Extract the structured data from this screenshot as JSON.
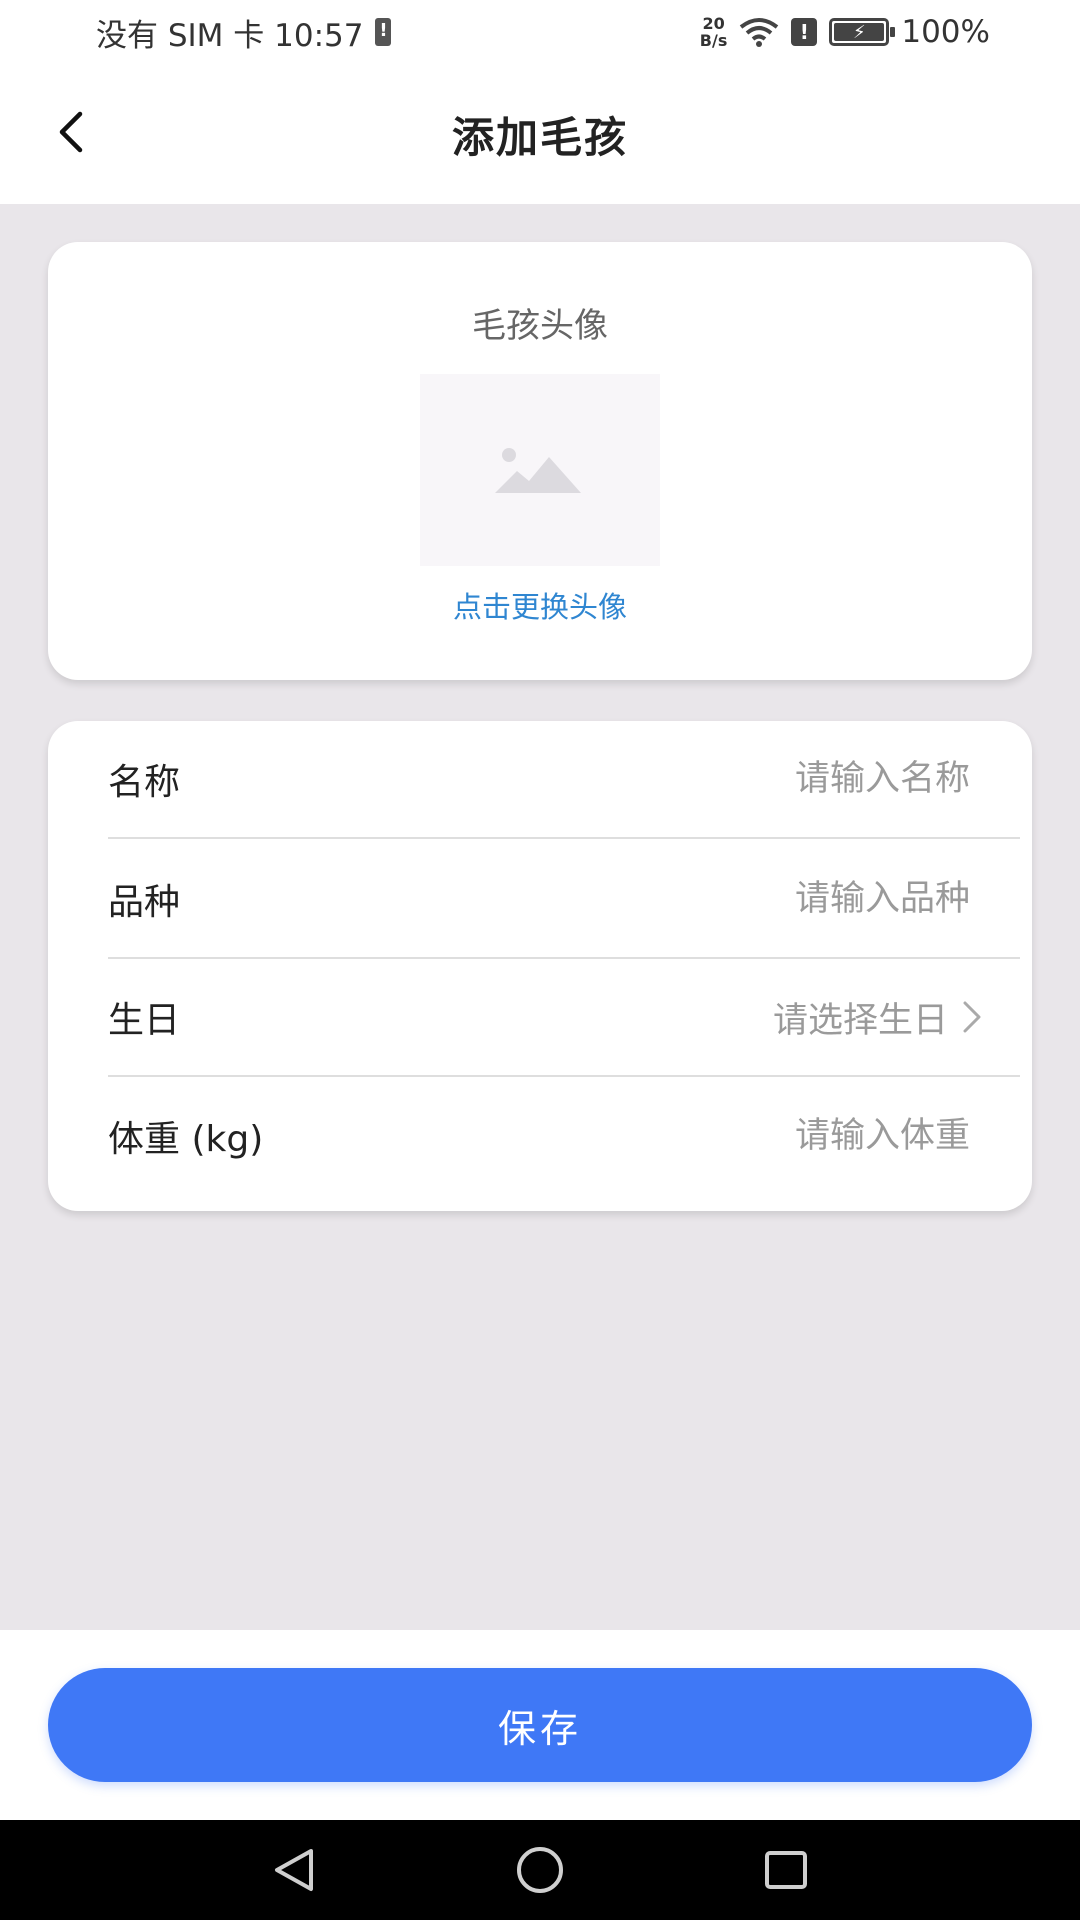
{
  "status_bar": {
    "carrier_time": "没有 SIM 卡 10:57",
    "net_speed_value": "20",
    "net_speed_unit": "B/s",
    "battery_percent": "100%"
  },
  "header": {
    "title": "添加毛孩"
  },
  "avatar": {
    "title": "毛孩头像",
    "change_label": "点击更换头像"
  },
  "form": {
    "fields": [
      {
        "label": "名称",
        "placeholder": "请输入名称",
        "value": ""
      },
      {
        "label": "品种",
        "placeholder": "请输入品种",
        "value": ""
      },
      {
        "label": "生日",
        "placeholder": "请选择生日",
        "value": ""
      },
      {
        "label": "体重 (kg)",
        "placeholder": "请输入体重",
        "value": ""
      }
    ]
  },
  "actions": {
    "save_label": "保存"
  },
  "colors": {
    "accent": "#3f78f6",
    "link": "#2f86d1",
    "background": "#e9e6ea"
  }
}
